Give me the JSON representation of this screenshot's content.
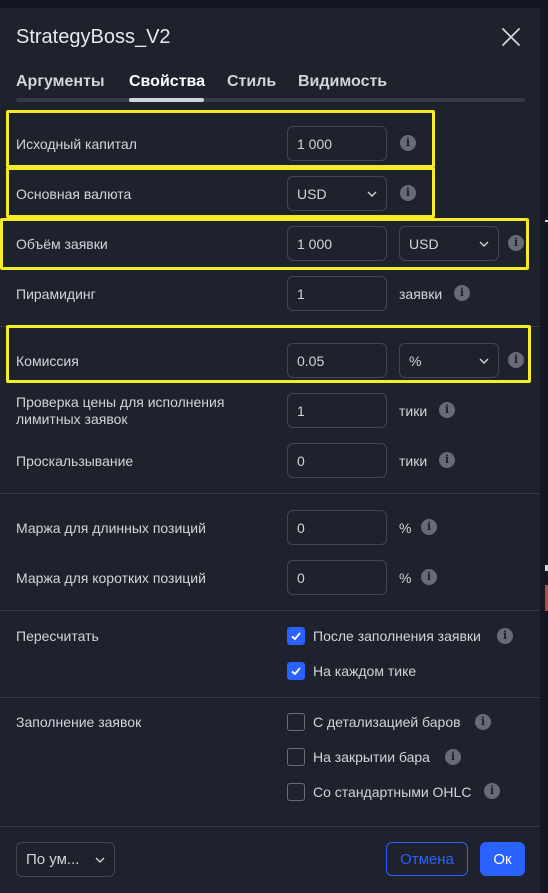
{
  "header": {
    "title": "StrategyBoss_V2"
  },
  "tabs": [
    {
      "label": "Аргументы",
      "active": false
    },
    {
      "label": "Свойства",
      "active": true
    },
    {
      "label": "Стиль",
      "active": false
    },
    {
      "label": "Видимость",
      "active": false
    }
  ],
  "fields": {
    "initial_capital": {
      "label": "Исходный капитал",
      "value": "1 000"
    },
    "base_currency": {
      "label": "Основная валюта",
      "value": "USD"
    },
    "order_size": {
      "label": "Объём заявки",
      "value": "1 000",
      "unit": "USD"
    },
    "pyramiding": {
      "label": "Пирамидинг",
      "value": "1",
      "unit": "заявки"
    },
    "commission": {
      "label": "Комиссия",
      "value": "0.05",
      "unit": "%"
    },
    "limit_check": {
      "label_line1": "Проверка цены для исполнения",
      "label_line2": "лимитных заявок",
      "value": "1",
      "unit": "тики"
    },
    "slippage": {
      "label": "Проскальзывание",
      "value": "0",
      "unit": "тики"
    },
    "margin_long": {
      "label": "Маржа для длинных позиций",
      "value": "0",
      "unit": "%"
    },
    "margin_short": {
      "label": "Маржа для коротких позиций",
      "value": "0",
      "unit": "%"
    }
  },
  "recalculate": {
    "label": "Пересчитать",
    "options": [
      {
        "label": "После заполнения заявки",
        "checked": true
      },
      {
        "label": "На каждом тике",
        "checked": true
      }
    ]
  },
  "fill_orders": {
    "label": "Заполнение заявок",
    "options": [
      {
        "label": "С детализацией баров",
        "checked": false
      },
      {
        "label": "На закрытии бара",
        "checked": false
      },
      {
        "label": "Со стандартными OHLC",
        "checked": false
      }
    ]
  },
  "footer": {
    "defaults_label": "По ум...",
    "cancel_label": "Отмена",
    "ok_label": "Ок"
  },
  "colors": {
    "background": "#1e222d",
    "accent": "#2962ff",
    "highlight": "#f4ec25"
  },
  "icons": [
    "close-icon",
    "info-icon",
    "chevron-down-icon",
    "checkmark-icon"
  ]
}
